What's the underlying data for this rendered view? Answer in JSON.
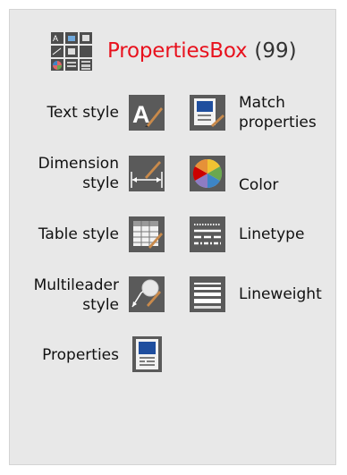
{
  "header": {
    "title": "PropertiesBox",
    "count": "(99)",
    "icon": "toolbox-grid-icon"
  },
  "tools": [
    {
      "label": "Text style",
      "icon": "text-style-icon"
    },
    {
      "label": "Match properties",
      "icon": "match-properties-icon"
    },
    {
      "label": "Dimension style",
      "icon": "dimension-style-icon"
    },
    {
      "label": "Color",
      "icon": "color-wheel-icon"
    },
    {
      "label": "Table style",
      "icon": "table-style-icon"
    },
    {
      "label": "Linetype",
      "icon": "linetype-icon"
    },
    {
      "label": "Multileader style",
      "icon": "multileader-style-icon"
    },
    {
      "label": "Lineweight",
      "icon": "lineweight-icon"
    },
    {
      "label": "Properties",
      "icon": "properties-icon"
    }
  ],
  "colors": {
    "title": "#e8121e",
    "panel_bg": "#e8e8e8",
    "icon_bg": "#5a5a5a"
  }
}
